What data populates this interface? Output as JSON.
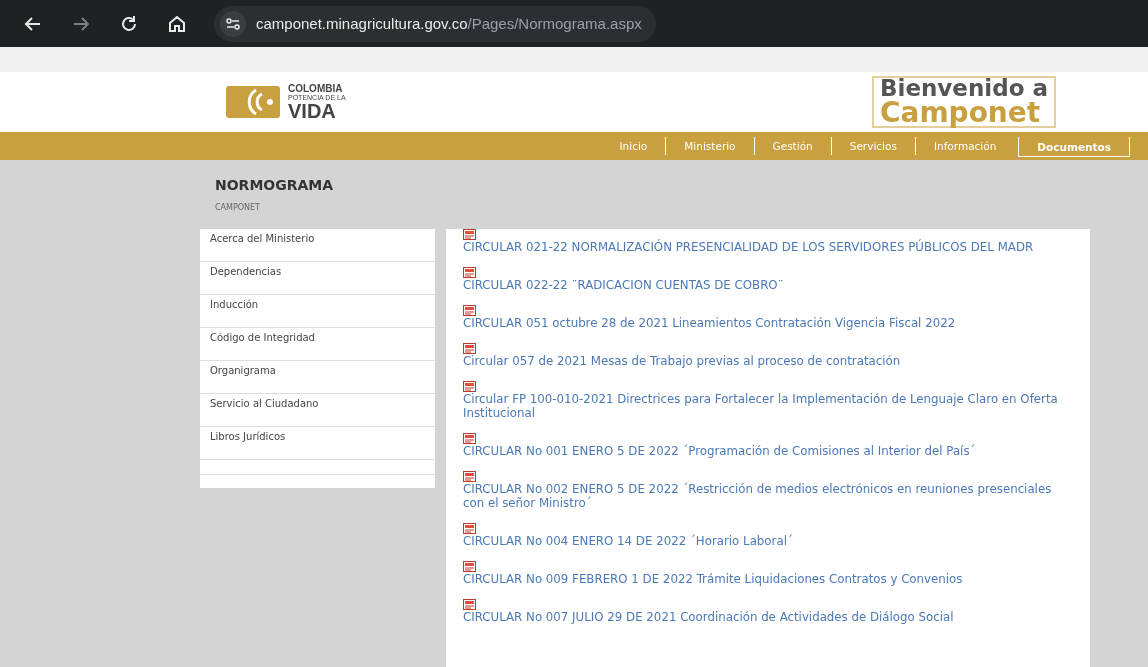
{
  "browser": {
    "url_host": "camponet.minagricultura.gov.co",
    "url_path": "/Pages/Normograma.aspx"
  },
  "header": {
    "logo": {
      "line1": "COLOMBIA",
      "line2": "POTENCIA DE LA",
      "line3": "VIDA"
    },
    "welcome": {
      "line1": "Bienvenido a",
      "line2": "Camponet"
    }
  },
  "nav": [
    {
      "label": "Inicio",
      "selected": false
    },
    {
      "label": "Ministerio",
      "selected": false
    },
    {
      "label": "Gestión",
      "selected": false
    },
    {
      "label": "Servicios",
      "selected": false
    },
    {
      "label": "Información",
      "selected": false
    },
    {
      "label": "Documentos",
      "selected": true
    }
  ],
  "page": {
    "title": "NORMOGRAMA",
    "breadcrumb": "CAMPONET"
  },
  "sidebar": {
    "items": [
      "Acerca del Ministerio",
      "Dependencias",
      "Inducción",
      "Código de Integridad",
      "Organigrama",
      "Servicio al Ciudadano",
      "Libros Jurídicos"
    ]
  },
  "documents": [
    "CIRCULAR 021-22 NORMALIZACIÓN PRESENCIALIDAD DE LOS SERVIDORES PÚBLICOS DEL MADR",
    "CIRCULAR 022-22 ¨RADICACION CUENTAS DE COBRO¨",
    "CIRCULAR 051 octubre 28 de 2021 Lineamientos Contratación Vigencia Fiscal 2022",
    "Circular 057 de 2021 Mesas de Trabajo previas al proceso de contratación",
    "Circular FP 100-010-2021 Directrices para Fortalecer la Implementación de Lenguaje Claro en Oferta Institucional",
    "CIRCULAR No 001 ENERO 5 DE 2022 ´Programación de Comisiones al Interior del País´",
    "CIRCULAR No 002 ENERO 5 DE 2022 ´Restricción de medios electrónicos en reuniones presenciales con el señor Ministro´",
    "CIRCULAR No 004 ENERO 14 DE 2022 ´Horario Laboral´",
    "CIRCULAR No 009 FEBRERO 1 DE 2022 Trámite Liquidaciones Contratos y Convenios",
    "CIRCULAR No 007 JULIO 29 DE 2021 Coordinación de Actividades de Diálogo Social"
  ]
}
